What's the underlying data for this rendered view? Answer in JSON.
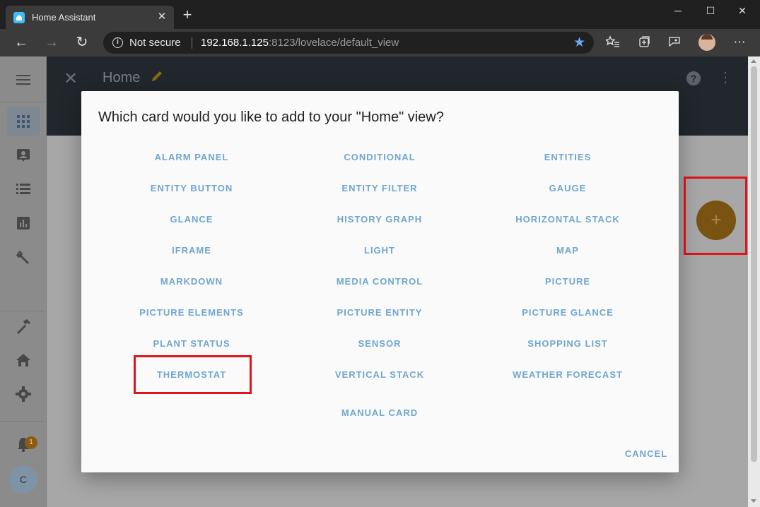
{
  "browser": {
    "tab_title": "Home Assistant",
    "tab_close": "✕",
    "new_tab": "+",
    "window_controls": [
      "─",
      "☐",
      "✕"
    ],
    "nav": {
      "back": "←",
      "forward": "→",
      "reload": "↻"
    },
    "security_label": "Not secure",
    "url_host": "192.168.1.125",
    "url_rest": ":8123/lovelace/default_view",
    "bookmark_icon": "★",
    "toolbar_icons": [
      "star-list-icon",
      "collections-icon",
      "feedback-icon",
      "profile-avatar",
      "more-icon"
    ],
    "more": "⋯"
  },
  "sidebar": {
    "icons": [
      "menu-icon",
      "dashboard-grid-icon",
      "map-icon",
      "logbook-list-icon",
      "history-chart-icon",
      "config-wrench-icon",
      "developer-hammer-icon",
      "hacs-home-icon",
      "settings-gear-icon",
      "notifications-bell-icon"
    ],
    "notification_count": "1",
    "user_initial": "C"
  },
  "header": {
    "title": "Home",
    "close": "✕",
    "help": "?",
    "more": "⋮"
  },
  "fab": {
    "label": "+"
  },
  "dialog": {
    "title": "Which card would you like to add to your \"Home\" view?",
    "cards": [
      "ALARM PANEL",
      "CONDITIONAL",
      "ENTITIES",
      "ENTITY BUTTON",
      "ENTITY FILTER",
      "GAUGE",
      "GLANCE",
      "HISTORY GRAPH",
      "HORIZONTAL STACK",
      "IFRAME",
      "LIGHT",
      "MAP",
      "MARKDOWN",
      "MEDIA CONTROL",
      "PICTURE",
      "PICTURE ELEMENTS",
      "PICTURE ENTITY",
      "PICTURE GLANCE",
      "PLANT STATUS",
      "SENSOR",
      "SHOPPING LIST",
      "THERMOSTAT",
      "VERTICAL STACK",
      "WEATHER FORECAST"
    ],
    "manual_card": "MANUAL CARD",
    "cancel": "CANCEL"
  },
  "colors": {
    "accent": "#70a6cf",
    "highlight": "#e2121b",
    "header_bg": "#21272c",
    "dialog_bg": "#fafafa"
  }
}
